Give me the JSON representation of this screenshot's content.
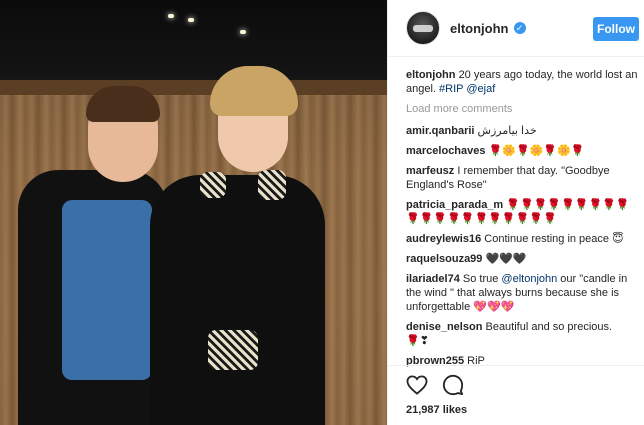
{
  "post": {
    "username": "eltonjohn",
    "follow_label": "Follow",
    "verified_glyph": "✓",
    "caption": {
      "user": "eltonjohn",
      "text": "20 years ago today, the world lost an angel. ",
      "tag": "#RIP",
      "mention": "@ejaf"
    },
    "load_more": "Load more comments",
    "comments": [
      {
        "user": "amir.qanbarii",
        "text": "خدا بیامرزش"
      },
      {
        "user": "marcelochaves",
        "text": "🌹🌼🌹🌼🌹🌼🌹"
      },
      {
        "user": "marfeusz",
        "text": "I remember that day. \"Goodbye England's Rose\""
      },
      {
        "user": "patricia_parada_m",
        "text": "🌹🌹🌹🌹🌹🌹🌹🌹🌹🌹🌹🌹🌹🌹🌹🌹🌹🌹🌹🌹"
      },
      {
        "user": "audreylewis16",
        "text": "Continue resting in peace 😇"
      },
      {
        "user": "raquelsouza99",
        "text": "🖤🖤🖤"
      },
      {
        "user": "ilariadel74",
        "text_before": "So true ",
        "mention": "@eltonjohn",
        "text_after": " our \"candle in the wind \" that always burns because she is unforgettable 💖💖💖"
      },
      {
        "user": "denise_nelson",
        "text": "Beautiful and so precious. 🌹❣"
      },
      {
        "user": "pbrown255",
        "text": "RiP"
      }
    ],
    "likes": "21,987 likes"
  },
  "icons": {
    "like": "heart-icon",
    "comment": "comment-icon"
  },
  "colors": {
    "accent": "#3897f0",
    "link": "#003569",
    "muted": "#999999"
  }
}
